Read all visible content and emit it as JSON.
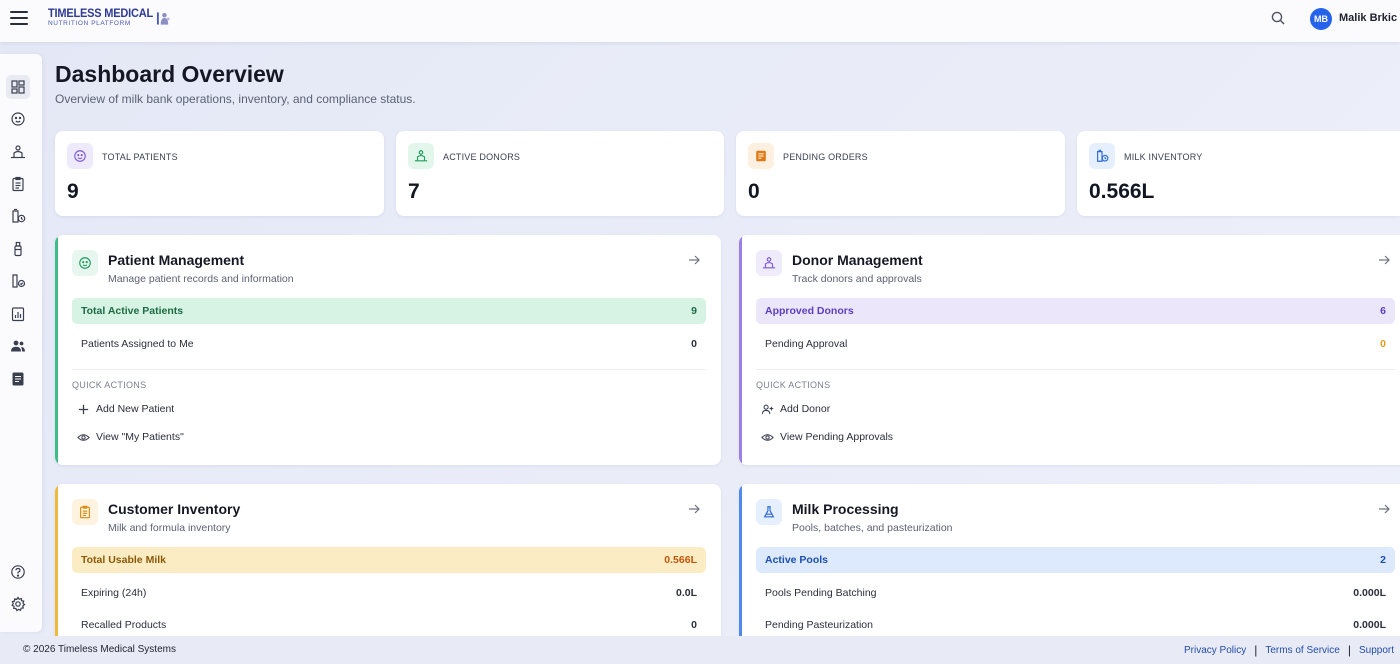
{
  "header": {
    "brand_line1": "TIMELESS MEDICAL",
    "brand_line2": "NUTRITION PLATFORM",
    "user_initials": "MB",
    "user_name": "Malik Brkic"
  },
  "sidebar": {
    "items": [
      {
        "icon": "dashboard-icon",
        "active": true
      },
      {
        "icon": "baby-face-icon"
      },
      {
        "icon": "donor-icon"
      },
      {
        "icon": "clipboard-icon"
      },
      {
        "icon": "milk-inventory-icon"
      },
      {
        "icon": "bottle-icon"
      },
      {
        "icon": "processing-icon"
      },
      {
        "icon": "reports-icon"
      },
      {
        "icon": "users-icon"
      },
      {
        "icon": "document-icon"
      }
    ],
    "bottom": [
      {
        "icon": "help-icon"
      },
      {
        "icon": "settings-icon"
      }
    ]
  },
  "page": {
    "title": "Dashboard Overview",
    "subtitle": "Overview of milk bank operations, inventory, and compliance status."
  },
  "stats": [
    {
      "label": "TOTAL PATIENTS",
      "value": "9",
      "icon": "baby-face-icon",
      "color": "#7c5cd6",
      "bg": "#efeafb"
    },
    {
      "label": "ACTIVE DONORS",
      "value": "7",
      "icon": "donor-icon",
      "color": "#1f9d5c",
      "bg": "#e3f6ec"
    },
    {
      "label": "PENDING ORDERS",
      "value": "0",
      "icon": "order-icon",
      "color": "#e07a14",
      "bg": "#fdf0e0"
    },
    {
      "label": "MILK INVENTORY",
      "value": "0.566L",
      "icon": "milk-inventory-icon",
      "color": "#2c6ad8",
      "bg": "#e6effd"
    }
  ],
  "modules": {
    "patient": {
      "title": "Patient Management",
      "subtitle": "Manage patient records and information",
      "highlight": {
        "label": "Total Active Patients",
        "value": "9"
      },
      "rows": [
        {
          "label": "Patients Assigned to Me",
          "value": "0"
        }
      ],
      "quick_actions_title": "QUICK ACTIONS",
      "actions": [
        "Add New Patient",
        "View \"My Patients\""
      ],
      "accent": "#3ebd86"
    },
    "donor": {
      "title": "Donor Management",
      "subtitle": "Track donors and approvals",
      "highlight": {
        "label": "Approved Donors",
        "value": "6"
      },
      "rows": [
        {
          "label": "Pending Approval",
          "value": "0"
        }
      ],
      "quick_actions_title": "QUICK ACTIONS",
      "actions": [
        "Add Donor",
        "View Pending Approvals"
      ],
      "accent": "#9b7ee6"
    },
    "inventory": {
      "title": "Customer Inventory",
      "subtitle": "Milk and formula inventory",
      "highlight": {
        "label": "Total Usable Milk",
        "value": "0.566L"
      },
      "rows": [
        {
          "label": "Expiring (24h)",
          "value": "0.0L"
        },
        {
          "label": "Recalled Products",
          "value": "0"
        }
      ],
      "accent": "#f1b93a"
    },
    "processing": {
      "title": "Milk Processing",
      "subtitle": "Pools, batches, and pasteurization",
      "highlight": {
        "label": "Active Pools",
        "value": "2"
      },
      "rows": [
        {
          "label": "Pools Pending Batching",
          "value": "0.000L"
        },
        {
          "label": "Pending Pasteurization",
          "value": "0.000L"
        }
      ],
      "accent": "#4f8ae8"
    }
  },
  "footer": {
    "copyright": "© 2026 Timeless Medical Systems",
    "links": [
      "Privacy Policy",
      "Terms of Service",
      "Support"
    ]
  }
}
